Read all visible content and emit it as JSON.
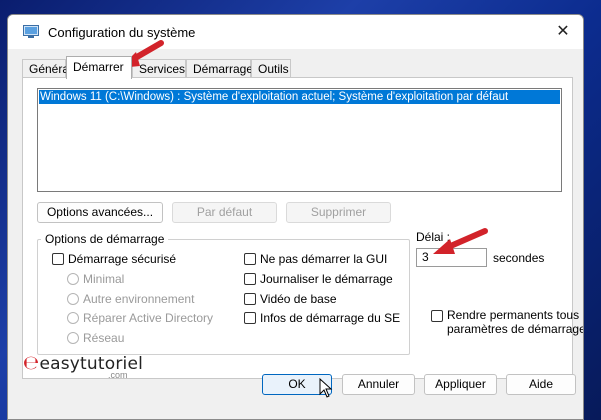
{
  "window": {
    "title": "Configuration du système"
  },
  "tabs": [
    {
      "label": "Général"
    },
    {
      "label": "Démarrer"
    },
    {
      "label": "Services"
    },
    {
      "label": "Démarrage"
    },
    {
      "label": "Outils"
    }
  ],
  "boot_list": {
    "items": [
      "Windows 11 (C:\\Windows) : Système d'exploitation actuel; Système d'exploitation par défaut"
    ]
  },
  "list_buttons": {
    "advanced": "Options avancées...",
    "default": "Par défaut",
    "delete": "Supprimer"
  },
  "boot_options": {
    "title": "Options de démarrage",
    "safe_boot": "Démarrage sécurisé",
    "radios": [
      "Minimal",
      "Autre environnement",
      "Réparer Active Directory",
      "Réseau"
    ],
    "no_gui": "Ne pas démarrer la GUI",
    "boot_log": "Journaliser le démarrage",
    "base_video": "Vidéo de base",
    "os_boot_info": "Infos de démarrage du SE"
  },
  "timeout": {
    "label": "Délai :",
    "value": "3",
    "unit": "secondes"
  },
  "permanent": {
    "line1": "Rendre permanents tous les",
    "line2": "paramètres de démarrage"
  },
  "footer": {
    "ok": "OK",
    "cancel": "Annuler",
    "apply": "Appliquer",
    "help": "Aide"
  },
  "watermark": {
    "brand": "easytutoriel",
    "suffix": ".com"
  },
  "colors": {
    "selection": "#0078d7",
    "arrow": "#d2232a"
  }
}
